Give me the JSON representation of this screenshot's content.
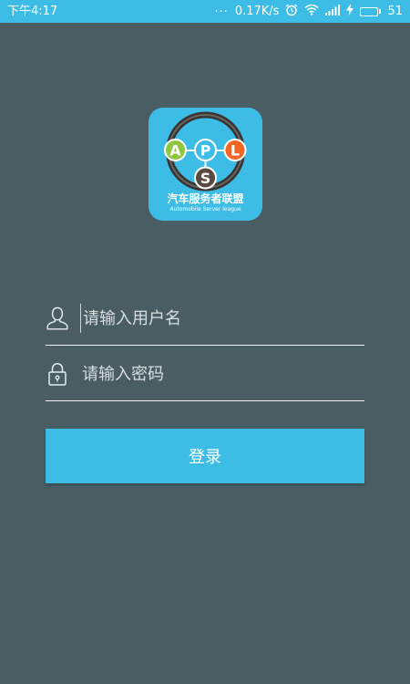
{
  "status_bar": {
    "time": "下午4:17",
    "dots": "...",
    "network_speed": "0.17K/s",
    "battery_level": "51",
    "icons": [
      "alarm-icon",
      "wifi-icon",
      "signal-icon",
      "charging-icon",
      "battery-icon"
    ]
  },
  "logo": {
    "letters": [
      "A",
      "P",
      "L",
      "S"
    ],
    "title_cn": "汽车服务者联盟",
    "subtitle_en": "Automobile Server league"
  },
  "form": {
    "username_placeholder": "请输入用户名",
    "password_placeholder": "请输入密码",
    "login_label": "登录"
  },
  "colors": {
    "background": "#4a5d63",
    "accent": "#3dbde6",
    "letter_a": "#8ec63f",
    "letter_p": "#3dbde6",
    "letter_l": "#f26522",
    "letter_s": "#5a4a3f"
  }
}
